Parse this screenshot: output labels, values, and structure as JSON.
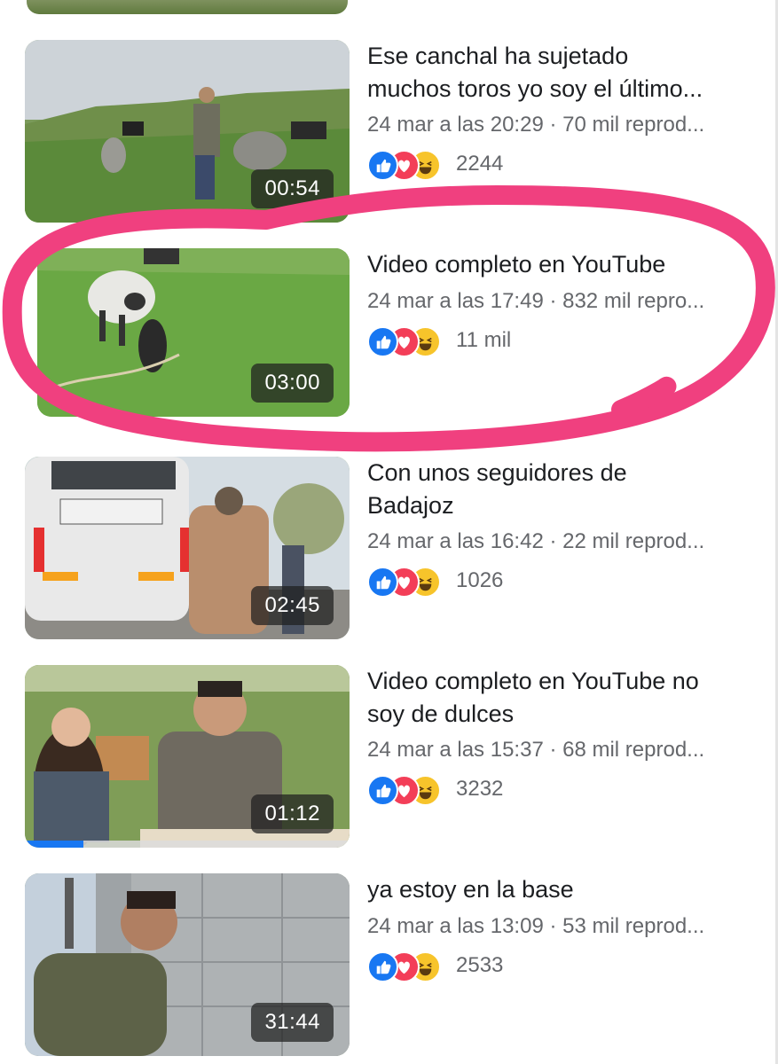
{
  "videos": [
    {
      "title": "Ese canchal ha sujetado\nmuchos toros yo soy el último...",
      "meta": "24 mar a las 20:29 · 70 mil reprod...",
      "reactions_count": "2244",
      "duration": "00:54"
    },
    {
      "title": "Video completo en YouTube",
      "meta": "24 mar a las 17:49 · 832 mil repro...",
      "reactions_count": "11 mil",
      "duration": "03:00"
    },
    {
      "title": "Con unos seguidores de\nBadajoz",
      "meta": "24 mar a las 16:42 · 22 mil reprod...",
      "reactions_count": "1026",
      "duration": "02:45"
    },
    {
      "title": "Video completo en YouTube no\nsoy de dulces",
      "meta": "24 mar a las 15:37 · 68 mil reprod...",
      "reactions_count": "3232",
      "duration": "01:12",
      "watched_progress": 0.18
    },
    {
      "title": "ya estoy en la base",
      "meta": "24 mar a las 13:09 · 53 mil reprod...",
      "reactions_count": "2533",
      "duration": "31:44"
    }
  ],
  "reaction_icons": [
    "like-icon",
    "love-icon",
    "haha-icon"
  ],
  "colors": {
    "highlight": "#f0407f",
    "like": "#1877f2",
    "love": "#f33e58",
    "haha": "#f7c42b"
  }
}
